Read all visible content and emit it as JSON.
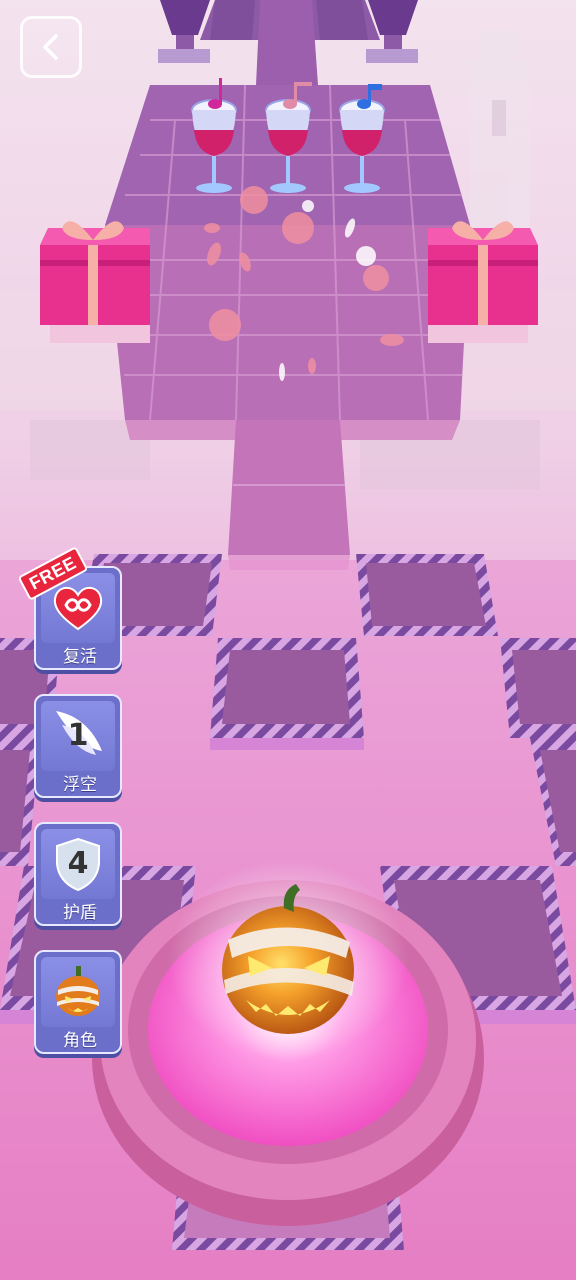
{
  "hud": {
    "back_icon": "chevron-left-icon"
  },
  "powerups": [
    {
      "label": "复活",
      "badge": "FREE",
      "icon": "infinity-heart-icon",
      "accent": "#e8253c"
    },
    {
      "label": "浮空",
      "count": "1",
      "icon": "wing-icon"
    },
    {
      "label": "护盾",
      "count": "4",
      "icon": "shield-icon"
    },
    {
      "label": "角色",
      "icon": "pumpkin-character-icon"
    }
  ],
  "colors": {
    "tile": "#9a5a9e",
    "track": "#c56fb4",
    "gift": "#e8308f",
    "pad_glow": "#ff5fd0",
    "pumpkin": "#e27b1c"
  }
}
